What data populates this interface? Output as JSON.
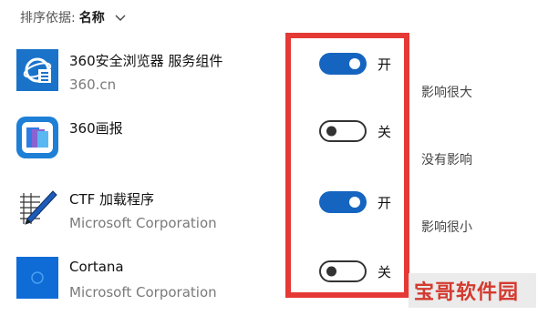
{
  "sort": {
    "label": "排序依据:",
    "value": "名称"
  },
  "apps": [
    {
      "name": "360安全浏览器 服务组件",
      "publisher": "360.cn",
      "state": "on",
      "state_label": "开",
      "icon": "360-browser-icon"
    },
    {
      "name": "360画报",
      "publisher": "",
      "state": "off",
      "state_label": "关",
      "icon": "360-wallpaper-icon"
    },
    {
      "name": "CTF 加载程序",
      "publisher": "Microsoft Corporation",
      "state": "on",
      "state_label": "开",
      "icon": "ctf-pen-icon"
    },
    {
      "name": "Cortana",
      "publisher": "Microsoft Corporation",
      "state": "off",
      "state_label": "关",
      "icon": "cortana-icon"
    }
  ],
  "impacts": [
    "影响很大",
    "没有影响",
    "影响很小"
  ],
  "colors": {
    "toggle_on": "#1565c0",
    "highlight_box": "#e53935",
    "watermark": "#d43a2f"
  },
  "watermark": {
    "text": "宝哥软件园"
  }
}
